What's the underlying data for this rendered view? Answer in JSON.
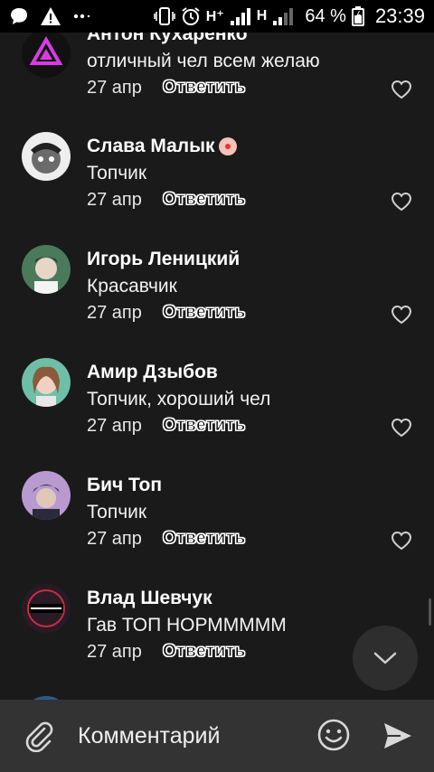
{
  "status_bar": {
    "net1": "H⁺",
    "net2": "H",
    "battery": "64 %",
    "time": "23:39",
    "icons": [
      "message-icon",
      "warning-icon",
      "dots-icon",
      "vibrate-icon",
      "alarm-icon",
      "signal-icon",
      "battery-icon"
    ]
  },
  "comments": [
    {
      "name": "Антон Кухаренко",
      "text": "отличный чел всем желаю",
      "date": "27 апр",
      "reply": "Ответить",
      "avatar_color": "#111111",
      "avatar_accent": "#d63de0"
    },
    {
      "name": "Слава Малык",
      "text": "Топчик",
      "date": "27 апр",
      "reply": "Ответить",
      "avatar_color": "#6b6b6b",
      "avatar_accent": "#cfcfcf"
    },
    {
      "name": "Игорь Леницкий",
      "text": "Красавчик",
      "date": "27 апр",
      "reply": "Ответить",
      "avatar_color": "#4a7a5a",
      "avatar_accent": "#e7d6c8"
    },
    {
      "name": "Амир Дзыбов",
      "text": "Топчик, хороший чел",
      "date": "27 апр",
      "reply": "Ответить",
      "avatar_color": "#6fbfa8",
      "avatar_accent": "#f1d0c4"
    },
    {
      "name": "Бич Топ",
      "text": "Топчик",
      "date": "27 апр",
      "reply": "Ответить",
      "avatar_color": "#b89ad0",
      "avatar_accent": "#2a2a3a"
    },
    {
      "name": "Влад Шевчук",
      "text": "Гав ТОП НОРМММММ",
      "date": "27 апр",
      "reply": "Ответить",
      "avatar_color": "#2a1a24",
      "avatar_accent": "#c0304a"
    }
  ],
  "composer": {
    "placeholder": "Комментарий"
  },
  "colors": {
    "background": "#1a1a1a",
    "composer": "#333333",
    "fab": "#2e2e2e"
  }
}
